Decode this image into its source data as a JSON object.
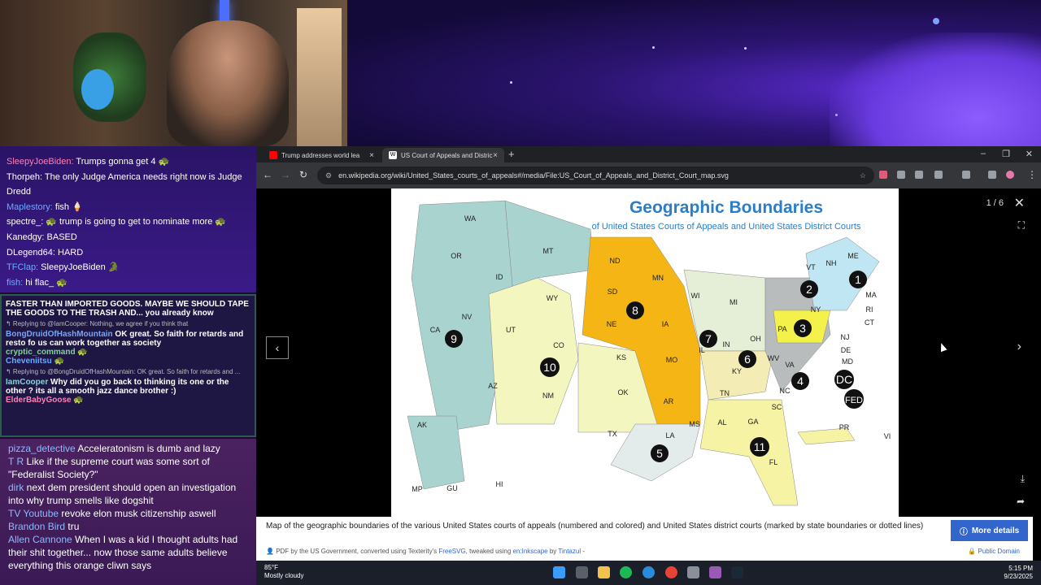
{
  "chat_top": [
    {
      "user": "SleepyJoeBiden",
      "text": " Trumps gonna get 4 🐢",
      "color": "#ff7fb6"
    },
    {
      "user": "Thorpeh",
      "text": " The only Judge America needs right now is Judge Dredd",
      "color": "#ffffff"
    },
    {
      "user": "Maplestory",
      "text": " fish 🍦",
      "color": "#6fa8ff"
    },
    {
      "user": "spectre_",
      "text": " 🐢 trump is going to get to nominate more 🐢",
      "color": "#ffffff"
    },
    {
      "user": "Kanedgy",
      "text": " BASED",
      "color": "#ffffff"
    },
    {
      "user": "DLegend64",
      "text": " HARD",
      "color": "#ffffff"
    },
    {
      "user": "TFClap",
      "text": " SleepyJoeBiden 🐊",
      "color": "#6fa8ff"
    },
    {
      "user": "fish",
      "text": " hi flac_ 🐢",
      "color": "#6fa8ff"
    }
  ],
  "chat_mid": {
    "banner": "FASTER THAN IMPORTED GOODS. MAYBE WE SHOULD TAPE THE GOODS TO THE TRASH AND... you already know",
    "reply1": "↰ Replying to @IamCooper: Nothing, we agree if you think that",
    "m1_user": "BongDruidOfHashMountain",
    "m1_text": " OK great. So faith for retards and resto fo us can work together as society",
    "m2_user": "cryptic_command",
    "m2_text": " 🐢",
    "m3_user": "Cheveniitsu",
    "m3_text": " 🐢",
    "reply2": "↰ Replying to @BongDruidOfHashMountain: OK great. So faith for retards and ...",
    "m4_user": "IamCooper",
    "m4_text": " Why did you go back to thinking its one or the other ? its all a smooth jazz dance brother :)",
    "m5_user": "ElderBabyGoose",
    "m5_text": " 🐢"
  },
  "chat_bottom": [
    {
      "user": "pizza_detective",
      "text": " Acceleratonism is dumb and lazy"
    },
    {
      "user": "T R",
      "text": " Like if the supreme court was some sort of \"Federalist Society?\""
    },
    {
      "user": "dirk",
      "text": " next dem president should open an investigation into why trump smells like dogshit"
    },
    {
      "user": "TV Youtube",
      "text": " revoke elon musk citizenship aswell"
    },
    {
      "user": "Brandon Bird",
      "text": " tru"
    },
    {
      "user": "Allen Cannone",
      "text": " When I was a kid I thought adults had their shit together... now those same adults believe everything this orange cliwn says"
    }
  ],
  "browser": {
    "tab1": "Trump addresses world lea",
    "tab2": "US Court of Appeals and Distric",
    "url": "en.wikipedia.org/wiki/United_States_courts_of_appeals#/media/File:US_Court_of_Appeals_and_District_Court_map.svg"
  },
  "viewer": {
    "counter": "1 / 6",
    "caption": "Map of the geographic boundaries of the various United States courts of appeals (numbered and colored) and United States district courts (marked by state boundaries or dotted lines)",
    "more_details": "More details",
    "license_prefix": "PDF by the US Government, converted using Texterity's ",
    "license_link1": "FreeSVG",
    "license_mid": ", tweaked using ",
    "license_link2": "en:Inkscape",
    "license_by": " by ",
    "license_link3": "Tintazul",
    "license_suffix": " -",
    "public_domain": "Public Domain"
  },
  "map": {
    "title": "Geographic Boundaries",
    "subtitle": "of United States Courts of Appeals and United States District Courts",
    "circuits": [
      "1",
      "2",
      "3",
      "4",
      "5",
      "6",
      "7",
      "8",
      "9",
      "10",
      "11",
      "DC",
      "FED"
    ],
    "states": [
      "WA",
      "OR",
      "ID",
      "MT",
      "WY",
      "ND",
      "SD",
      "NE",
      "MN",
      "IA",
      "WI",
      "MI",
      "IL",
      "IN",
      "OH",
      "KY",
      "TN",
      "MO",
      "KS",
      "CO",
      "UT",
      "NV",
      "CA",
      "AZ",
      "NM",
      "OK",
      "TX",
      "AR",
      "LA",
      "MS",
      "AL",
      "GA",
      "FL",
      "SC",
      "NC",
      "VA",
      "WV",
      "PA",
      "NY",
      "VT",
      "NH",
      "ME",
      "MA",
      "RI",
      "CT",
      "NJ",
      "DE",
      "MD",
      "AK",
      "HI",
      "PR",
      "VI",
      "MP",
      "GU"
    ]
  },
  "taskbar": {
    "temp": "85°F",
    "weather": "Mostly cloudy",
    "time": "5:15 PM",
    "date": "9/23/2025"
  }
}
